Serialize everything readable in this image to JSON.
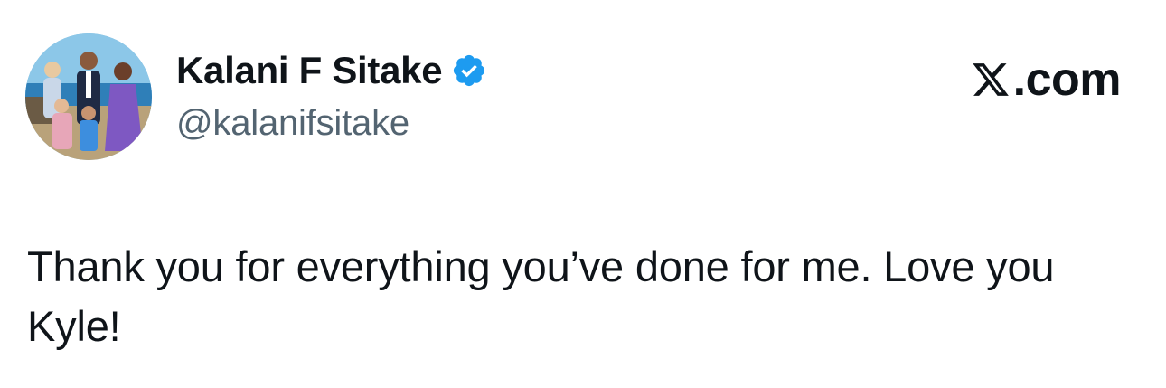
{
  "author": {
    "display_name": "Kalani F Sitake",
    "handle": "@kalanifsitake",
    "verified": true,
    "verified_color": "#1d9bf0"
  },
  "brand": {
    "icon": "x-logo-icon",
    "text": ".com"
  },
  "tweet": {
    "text": "Thank you for everything you’ve done for me. Love you Kyle!"
  },
  "colors": {
    "text_primary": "#0f1419",
    "text_secondary": "#536471",
    "background": "#ffffff"
  }
}
